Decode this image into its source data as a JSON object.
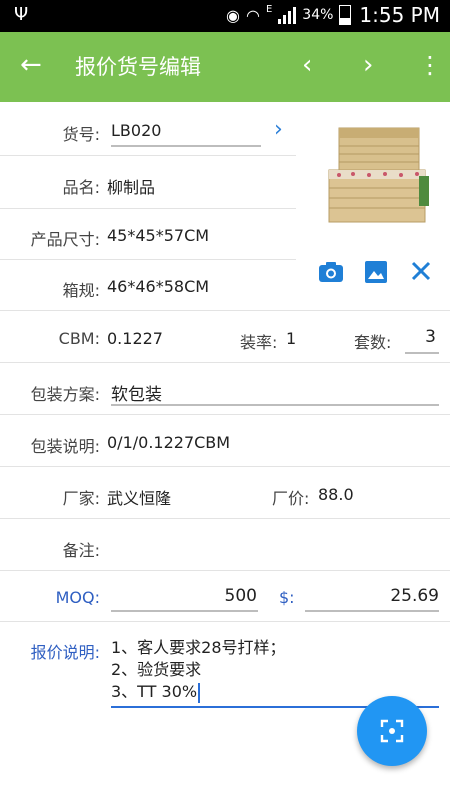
{
  "status_bar": {
    "battery": "34%",
    "network": "E",
    "time": "1:55 PM"
  },
  "toolbar": {
    "title": "报价货号编辑"
  },
  "form": {
    "item_no": {
      "label": "货号:",
      "value": "LB020"
    },
    "product_name": {
      "label": "品名:",
      "value": "柳制品"
    },
    "product_size": {
      "label": "产品尺寸:",
      "value": "45*45*57CM"
    },
    "carton_size": {
      "label": "箱规:",
      "value": "46*46*58CM"
    },
    "cbm": {
      "label": "CBM:",
      "value": "0.1227"
    },
    "packing_rate": {
      "label": "装率:",
      "value": "1"
    },
    "sets": {
      "label": "套数:",
      "value": "3"
    },
    "packing_plan": {
      "label": "包装方案:",
      "value": "软包装"
    },
    "packing_desc": {
      "label": "包装说明:",
      "value": "0/1/0.1227CBM"
    },
    "factory": {
      "label": "厂家:",
      "value": "武义恒隆"
    },
    "factory_price": {
      "label": "厂价:",
      "value": "88.0"
    },
    "remark": {
      "label": "备注:",
      "value": ""
    },
    "moq": {
      "label": "MOQ:",
      "value": "500"
    },
    "price": {
      "label": "$:",
      "value": "25.69"
    },
    "quote_note": {
      "label": "报价说明:",
      "lines": [
        "1、客人要求28号打样；",
        "2、验货要求",
        "3、TT 30%"
      ]
    }
  },
  "colors": {
    "toolbar": "#7cc152",
    "accent_blue": "#2196f3",
    "label_blue": "#2f5fc2"
  }
}
